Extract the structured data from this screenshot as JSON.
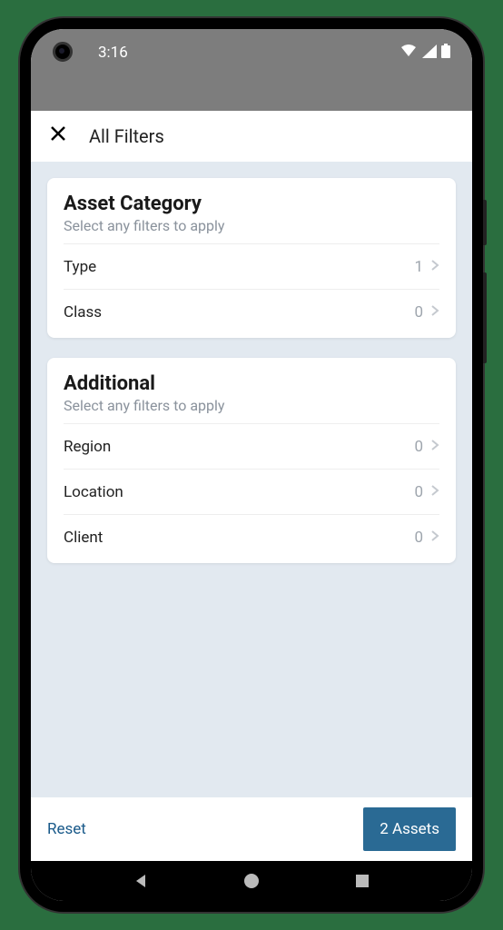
{
  "statusBar": {
    "time": "3:16"
  },
  "header": {
    "title": "All Filters"
  },
  "sections": [
    {
      "title": "Asset Category",
      "subtitle": "Select any filters to apply",
      "filters": [
        {
          "label": "Type",
          "count": "1"
        },
        {
          "label": "Class",
          "count": "0"
        }
      ]
    },
    {
      "title": "Additional",
      "subtitle": "Select any filters to apply",
      "filters": [
        {
          "label": "Region",
          "count": "0"
        },
        {
          "label": "Location",
          "count": "0"
        },
        {
          "label": "Client",
          "count": "0"
        }
      ]
    }
  ],
  "footer": {
    "resetLabel": "Reset",
    "assetsLabel": "2 Assets"
  }
}
